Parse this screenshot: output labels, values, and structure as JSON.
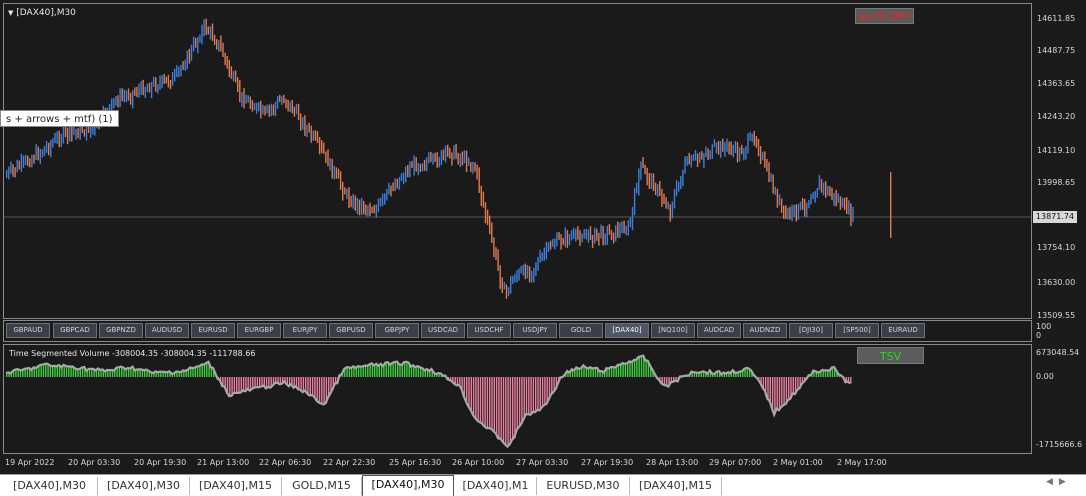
{
  "chart": {
    "title": "[DAX40],M30",
    "collapse_icon": "triangle-down-icon"
  },
  "price_axis": [
    "14611.85",
    "14487.75",
    "14363.65",
    "14243.20",
    "14119.10",
    "13998.65",
    "13754.10",
    "13630.00",
    "13509.55"
  ],
  "current_price": "13871.74",
  "xu_button": "xu hl OFF",
  "tooltip": "s + arrows + mtf) (1)",
  "symbols": [
    {
      "label": "GBPAUD",
      "active": false
    },
    {
      "label": "GBPCAD",
      "active": false
    },
    {
      "label": "GBPNZD",
      "active": false
    },
    {
      "label": "AUDUSD",
      "active": false
    },
    {
      "label": "EURUSD",
      "active": false
    },
    {
      "label": "EURGBP",
      "active": false
    },
    {
      "label": "EURJPY",
      "active": false
    },
    {
      "label": "GBPUSD",
      "active": false
    },
    {
      "label": "GBPJPY",
      "active": false
    },
    {
      "label": "USDCAD",
      "active": false
    },
    {
      "label": "USDCHF",
      "active": false
    },
    {
      "label": "USDJPY",
      "active": false
    },
    {
      "label": "GOLD",
      "active": false
    },
    {
      "label": "[DAX40]",
      "active": true
    },
    {
      "label": "[NQ100]",
      "active": false
    },
    {
      "label": "AUDCAD",
      "active": false
    },
    {
      "label": "AUDNZD",
      "active": false
    },
    {
      "label": "[DJI30]",
      "active": false
    },
    {
      "label": "[SP500]",
      "active": false
    },
    {
      "label": "EURAUD",
      "active": false
    }
  ],
  "bar_axis": [
    "100",
    "0"
  ],
  "tsv": {
    "title": "Time Segmented Volume -308004.35 -308004.35 -111788.66",
    "button": "TSV",
    "axis": [
      "673048.54",
      "0.00",
      "-1715666.6"
    ]
  },
  "time_axis": [
    "19 Apr 2022",
    "20 Apr 03:30",
    "20 Apr 19:30",
    "21 Apr 13:00",
    "22 Apr 06:30",
    "22 Apr 22:30",
    "25 Apr 16:30",
    "26 Apr 10:00",
    "27 Apr 03:30",
    "27 Apr 19:30",
    "28 Apr 13:00",
    "29 Apr 07:00",
    "2 May 01:00",
    "2 May 17:00"
  ],
  "tabs": [
    "[DAX40],M30",
    "[DAX40],M30",
    "[DAX40],M15",
    "GOLD,M15",
    "[DAX40],M30",
    "[DAX40],M1",
    "EURUSD,M30",
    "[DAX40],M15"
  ],
  "active_tab": 4,
  "colors": {
    "bull": "#3d7fd9",
    "bear": "#e07a4f",
    "tsv_pos": "#3ecf3e",
    "tsv_neg": "#e8809f",
    "tsv_line": "#a8a8a8"
  },
  "nav_icons": [
    "arrow-left-icon",
    "arrow-right-icon"
  ]
}
